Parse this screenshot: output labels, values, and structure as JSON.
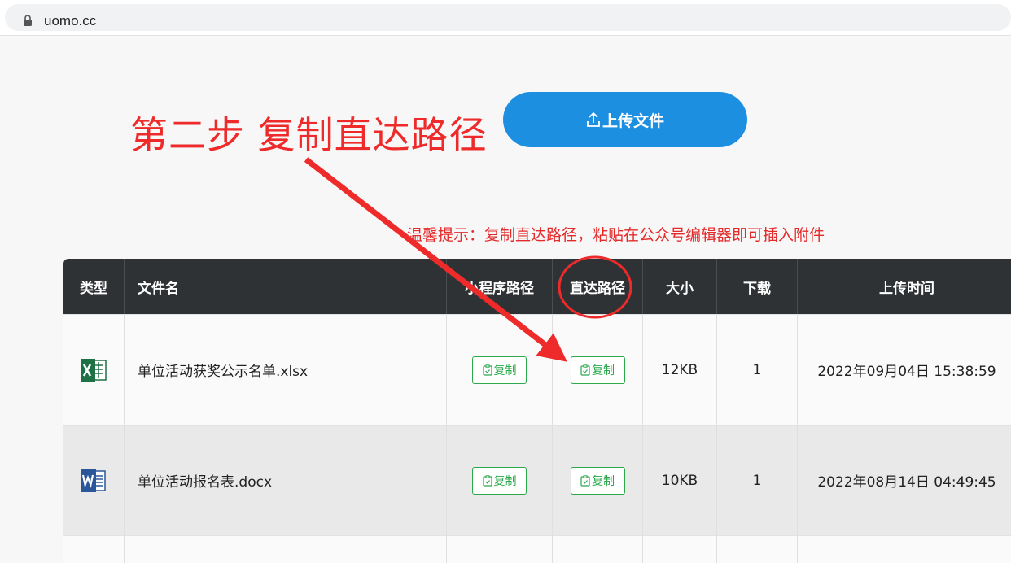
{
  "browser": {
    "url": "uomo.cc"
  },
  "annotation": {
    "step_text": "第二步 复制直达路径"
  },
  "upload": {
    "label": "上传文件"
  },
  "tip": {
    "text": "温馨提示：复制直达路径，粘贴在公众号编辑器即可插入附件"
  },
  "table": {
    "headers": [
      "类型",
      "文件名",
      "小程序路径",
      "直达路径",
      "大小",
      "下载",
      "上传时间"
    ],
    "rows": [
      {
        "type_icon": "excel-icon",
        "filename": "单位活动获奖公示名单.xlsx",
        "mini_copy": "复制",
        "direct_copy": "复制",
        "size": "12KB",
        "downloads": "1",
        "uploaded": "2022年09月04日 15:38:59"
      },
      {
        "type_icon": "word-icon",
        "filename": "单位活动报名表.docx",
        "mini_copy": "复制",
        "direct_copy": "复制",
        "size": "10KB",
        "downloads": "1",
        "uploaded": "2022年08月14日 04:49:45"
      }
    ]
  },
  "colors": {
    "accent": "#1d8fe1",
    "annotation_red": "#ee2a2a",
    "copy_green": "#2ba84a",
    "header_bg": "#2f3235"
  }
}
